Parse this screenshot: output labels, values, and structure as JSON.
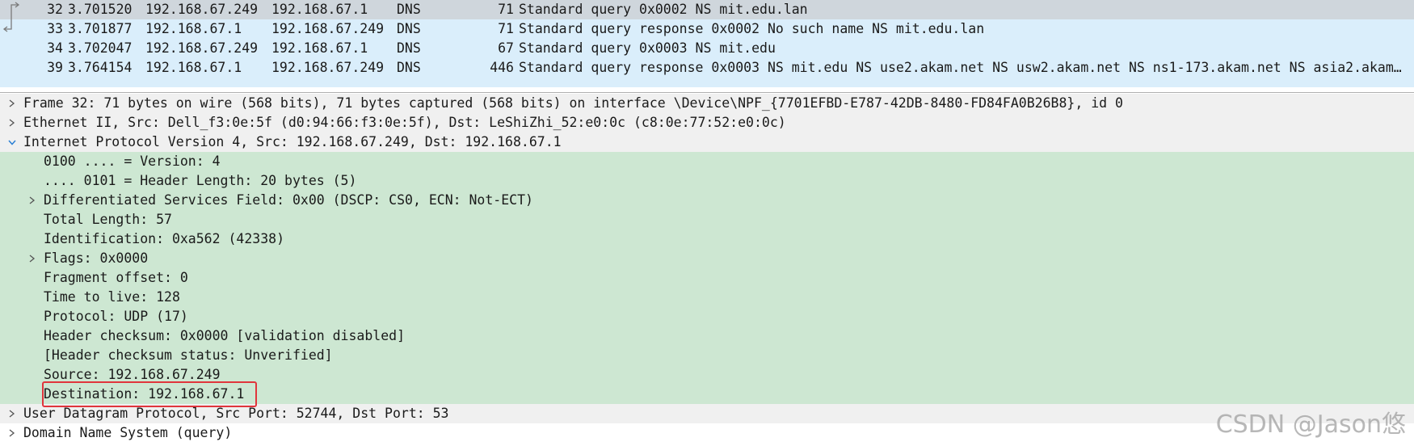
{
  "packet_list": {
    "rows": [
      {
        "no": "32",
        "time": "3.701520",
        "src": "192.168.67.249",
        "dst": "192.168.67.1",
        "proto": "DNS",
        "len": "71",
        "info": "Standard query 0x0002 NS mit.edu.lan"
      },
      {
        "no": "33",
        "time": "3.701877",
        "src": "192.168.67.1",
        "dst": "192.168.67.249",
        "proto": "DNS",
        "len": "71",
        "info": "Standard query response 0x0002 No such name NS mit.edu.lan"
      },
      {
        "no": "34",
        "time": "3.702047",
        "src": "192.168.67.249",
        "dst": "192.168.67.1",
        "proto": "DNS",
        "len": "67",
        "info": "Standard query 0x0003 NS mit.edu"
      },
      {
        "no": "39",
        "time": "3.764154",
        "src": "192.168.67.1",
        "dst": "192.168.67.249",
        "proto": "DNS",
        "len": "446",
        "info": "Standard query response 0x0003 NS mit.edu NS use2.akam.net NS usw2.akam.net NS ns1-173.akam.net NS asia2.akam…"
      }
    ],
    "selected_index": 0
  },
  "packet_details": {
    "frame": "Frame 32: 71 bytes on wire (568 bits), 71 bytes captured (568 bits) on interface \\Device\\NPF_{7701EFBD-E787-42DB-8480-FD84FA0B26B8}, id 0",
    "ethernet": "Ethernet II, Src: Dell_f3:0e:5f (d0:94:66:f3:0e:5f), Dst: LeShiZhi_52:e0:0c (c8:0e:77:52:e0:0c)",
    "ipv4": {
      "title": "Internet Protocol Version 4, Src: 192.168.67.249, Dst: 192.168.67.1",
      "fields": {
        "version": "0100 .... = Version: 4",
        "header_length": ".... 0101 = Header Length: 20 bytes (5)",
        "dsf": "Differentiated Services Field: 0x00 (DSCP: CS0, ECN: Not-ECT)",
        "total_length": "Total Length: 57",
        "identification": "Identification: 0xa562 (42338)",
        "flags": "Flags: 0x0000",
        "fragment_offset": "Fragment offset: 0",
        "ttl": "Time to live: 128",
        "protocol": "Protocol: UDP (17)",
        "checksum": "Header checksum: 0x0000 [validation disabled]",
        "checksum_status": "[Header checksum status: Unverified]",
        "source": "Source: 192.168.67.249",
        "destination": "Destination: 192.168.67.1"
      }
    },
    "udp": "User Datagram Protocol, Src Port: 52744, Dst Port: 53",
    "dns": "Domain Name System (query)"
  },
  "watermark": "CSDN @Jason悠",
  "colors": {
    "packet_list_bg": "#daeefb",
    "selected_row_bg": "#cfd6dc",
    "expanded_section_bg": "#cde7d2",
    "highlight_border": "#e0353c"
  }
}
